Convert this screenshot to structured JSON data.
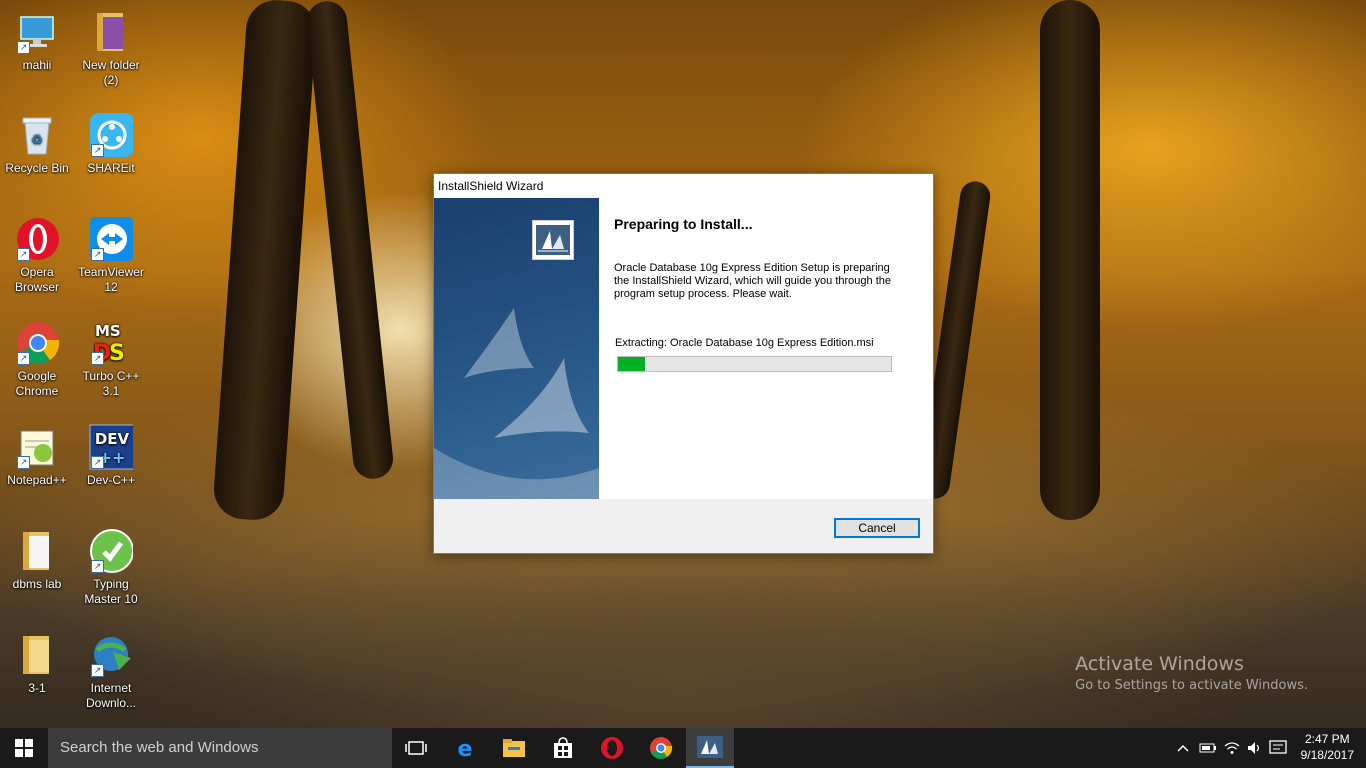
{
  "desktop": {
    "icons": [
      {
        "label": "mahii"
      },
      {
        "label": "New folder\n(2)"
      },
      {
        "label": "Recycle Bin"
      },
      {
        "label": "SHAREit"
      },
      {
        "label": "Opera\nBrowser"
      },
      {
        "label": "TeamViewer\n12"
      },
      {
        "label": "Google\nChrome"
      },
      {
        "label": "Turbo C++\n3.1"
      },
      {
        "label": "Notepad++"
      },
      {
        "label": "Dev-C++"
      },
      {
        "label": "dbms lab"
      },
      {
        "label": "Typing\nMaster 10"
      },
      {
        "label": "3-1"
      },
      {
        "label": "Internet\nDownlo..."
      }
    ]
  },
  "wizard": {
    "title": "InstallShield Wizard",
    "heading": "Preparing to Install...",
    "description_lines": [
      "Oracle Database 10g Express Edition Setup is preparing",
      "the InstallShield Wizard, which will guide you through the",
      "program setup process.  Please wait."
    ],
    "status": "Extracting: Oracle Database 10g Express Edition.msi",
    "progress_percent": 10,
    "cancel_label": "Cancel"
  },
  "watermark": {
    "title": "Activate Windows",
    "subtitle": "Go to Settings to activate Windows."
  },
  "taskbar": {
    "search_placeholder": "Search the web and Windows",
    "apps": [
      "task-view-icon",
      "edge-icon",
      "file-explorer-icon",
      "store-icon",
      "opera-icon",
      "chrome-icon",
      "installshield-icon"
    ],
    "time": "2:47 PM",
    "date": "9/18/2017"
  },
  "colors": {
    "progress": "#06b025",
    "accent": "#0078d7",
    "taskbar": "#1a1a1a"
  }
}
